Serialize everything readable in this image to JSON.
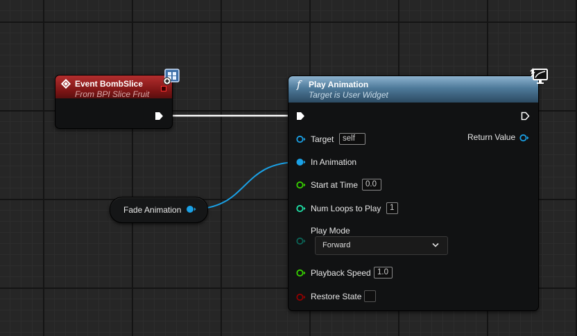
{
  "event_node": {
    "title": "Event BombSlice",
    "subtitle": "From BPI Slice Fruit",
    "icon": "event-diamond-icon",
    "badge_icon": "interface-icon"
  },
  "play_node": {
    "function_symbol": "f",
    "title": "Play Animation",
    "subtitle": "Target is User Widget",
    "badge_icon": "widget-monitor-icon",
    "pins": {
      "target": {
        "label": "Target",
        "value": "self"
      },
      "return_value": {
        "label": "Return Value"
      },
      "in_animation": {
        "label": "In Animation"
      },
      "start_at_time": {
        "label": "Start at Time",
        "value": "0.0"
      },
      "num_loops": {
        "label": "Num Loops to Play",
        "value": "1"
      },
      "play_mode": {
        "label": "Play Mode",
        "value": "Forward"
      },
      "playback_speed": {
        "label": "Playback Speed",
        "value": "1.0"
      },
      "restore_state": {
        "label": "Restore State",
        "checked": false
      }
    }
  },
  "fade_node": {
    "label": "Fade Animation"
  },
  "colors": {
    "object_pin": "#1aa1e6",
    "float_pin": "#38d400",
    "int_pin": "#1fe3a8",
    "bool_pin": "#920101",
    "enum_pin": "#0b6457",
    "exec_pin": "#ffffff",
    "event_header": "#9e2222",
    "function_header": "#5d87a6"
  }
}
